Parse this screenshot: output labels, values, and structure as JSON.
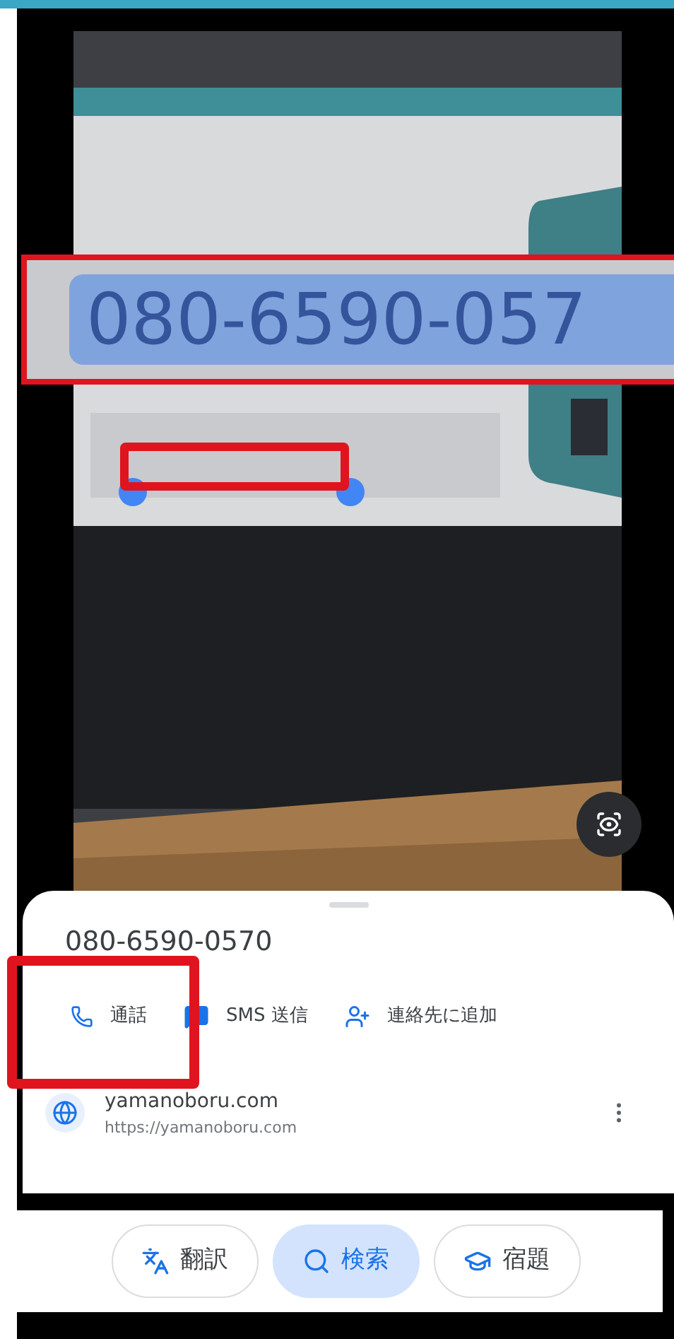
{
  "callout": {
    "text": "080-6590-057"
  },
  "sheet": {
    "title": "080-6590-0570",
    "actions": [
      {
        "kind": "call",
        "label": "通話"
      },
      {
        "kind": "sms",
        "label": "SMS 送信"
      },
      {
        "kind": "contact",
        "label": "連絡先に追加"
      }
    ],
    "result": {
      "title": "yamanoboru.com",
      "url": "https://yamanoboru.com"
    }
  },
  "modes": [
    {
      "kind": "translate",
      "label": "翻訳",
      "selected": false
    },
    {
      "kind": "search",
      "label": "検索",
      "selected": true
    },
    {
      "kind": "homework",
      "label": "宿題",
      "selected": false
    }
  ]
}
